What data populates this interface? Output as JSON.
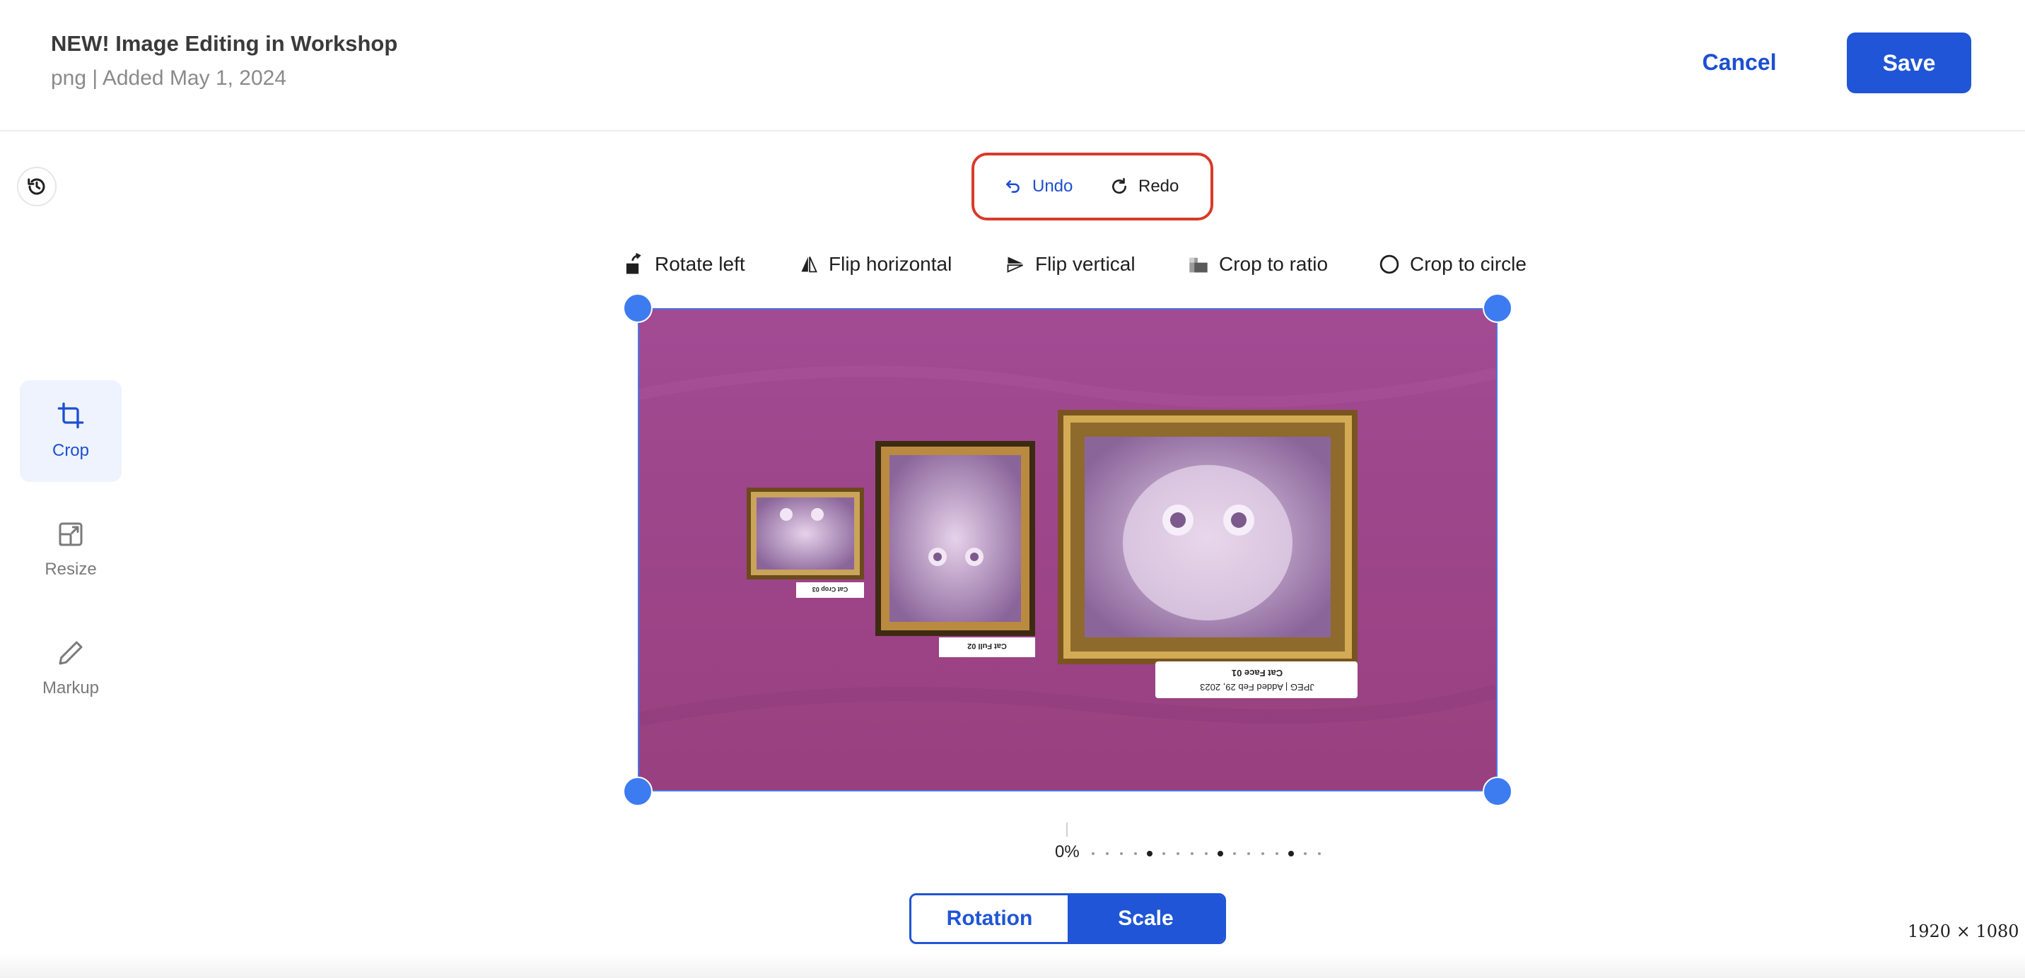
{
  "header": {
    "title": "NEW! Image Editing in Workshop",
    "subtitle": "png | Added May 1, 2024",
    "cancel_label": "Cancel",
    "save_label": "Save"
  },
  "sidebar": {
    "items": [
      {
        "label": "Crop",
        "icon": "crop-icon",
        "active": true
      },
      {
        "label": "Resize",
        "icon": "resize-icon",
        "active": false
      },
      {
        "label": "Markup",
        "icon": "pencil-icon",
        "active": false
      }
    ]
  },
  "history": {
    "undo_label": "Undo",
    "redo_label": "Redo"
  },
  "actions": [
    {
      "label": "Rotate left",
      "icon": "rotate-left-icon"
    },
    {
      "label": "Flip horizontal",
      "icon": "flip-horizontal-icon"
    },
    {
      "label": "Flip vertical",
      "icon": "flip-vertical-icon"
    },
    {
      "label": "Crop to ratio",
      "icon": "crop-ratio-icon"
    },
    {
      "label": "Crop to circle",
      "icon": "circle-icon"
    }
  ],
  "image": {
    "background_color": "#a0468f",
    "labels": [
      "Cat Crop 03",
      "Cat Full 02",
      "Cat Face 01",
      "JPEG | Added Feb 29, 2023"
    ]
  },
  "slider": {
    "value_text": "0%"
  },
  "modes": {
    "rotation_label": "Rotation",
    "scale_label": "Scale",
    "selected": "Scale"
  },
  "dimensions": "1920 × 1080",
  "colors": {
    "accent": "#1f55d6",
    "highlight": "#d93a2b",
    "handle": "#3d7cf0"
  }
}
